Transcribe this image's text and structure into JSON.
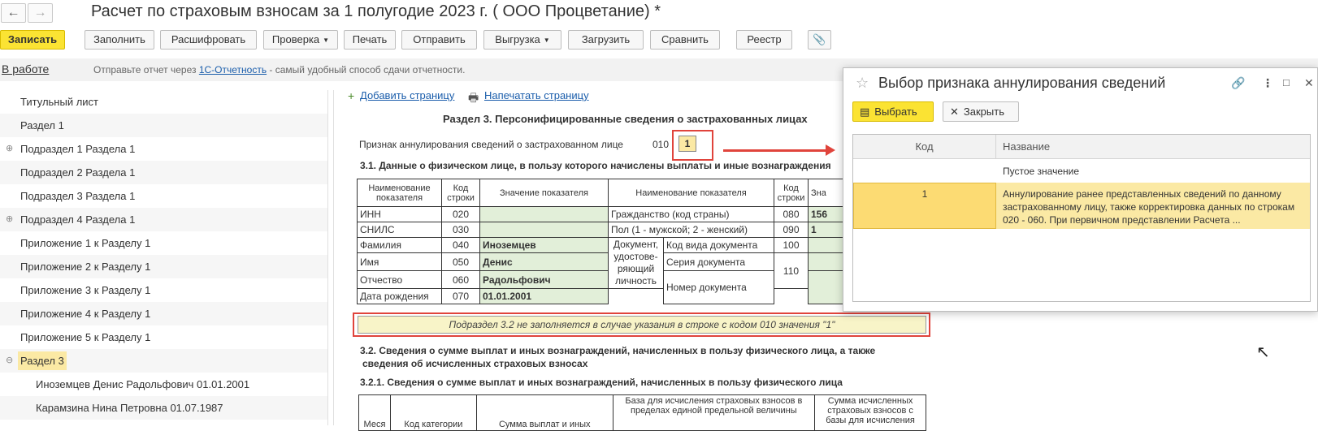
{
  "window": {
    "title": "Расчет по страховым взносам за 1 полугодие 2023 г. ( ООО Процветание) *",
    "back_icon": "arrow-left-icon",
    "forward_icon": "arrow-right-icon"
  },
  "toolbar": {
    "save": "Записать",
    "fill": "Заполнить",
    "decode": "Расшифровать",
    "check": "Проверка",
    "print": "Печать",
    "send": "Отправить",
    "export": "Выгрузка",
    "load": "Загрузить",
    "compare": "Сравнить",
    "registry": "Реестр",
    "attach_icon": "paperclip-icon"
  },
  "infobar": {
    "status": "В работе",
    "text_before": "Отправьте отчет через ",
    "link": "1С-Отчетность",
    "text_after": " - самый удобный способ сдачи отчетности."
  },
  "sidebar": {
    "items": [
      {
        "label": "Титульный лист"
      },
      {
        "label": "Раздел 1"
      },
      {
        "label": "Подраздел 1 Раздела 1",
        "expand": "⊕"
      },
      {
        "label": "Подраздел 2 Раздела 1"
      },
      {
        "label": "Подраздел 3 Раздела 1"
      },
      {
        "label": "Подраздел 4 Раздела 1",
        "expand": "⊕"
      },
      {
        "label": "Приложение 1 к Разделу 1"
      },
      {
        "label": "Приложение 2 к Разделу 1"
      },
      {
        "label": "Приложение 3 к Разделу 1"
      },
      {
        "label": "Приложение 4 к Разделу 1"
      },
      {
        "label": "Приложение 5 к Разделу 1"
      },
      {
        "label": "Раздел 3",
        "expand": "⊖"
      },
      {
        "label": "Иноземцев Денис Радольфович 01.01.2001"
      },
      {
        "label": "Карамзина Нина Петровна 01.07.1987"
      }
    ]
  },
  "report": {
    "add_page": "Добавить страницу",
    "print_page": "Напечатать страницу",
    "section_title": "Раздел 3. Персонифицированные сведения о застрахованных лицах",
    "annul_label": "Признак аннулирования сведений о застрахованном лице",
    "annul_code": "010",
    "annul_value": "1",
    "sub31": "3.1. Данные о физическом лице, в пользу которого начислены выплаты и иные вознаграждения",
    "table": {
      "h_name": "Наименование показателя",
      "h_code": "Код строки",
      "h_value": "Значение показателя",
      "h_name2": "Наименование показателя",
      "h_code2": "Код строки",
      "h_value2": "Зна",
      "rows": [
        {
          "name": "ИНН",
          "code": "020",
          "value": "",
          "name2": "Гражданство (код страны)",
          "code2": "080",
          "value2": "156"
        },
        {
          "name": "СНИЛС",
          "code": "030",
          "value": "",
          "name2": "Пол (1 - мужской; 2 - женский)",
          "code2": "090",
          "value2": "1"
        },
        {
          "name": "Фамилия",
          "code": "040",
          "value": "Иноземцев",
          "name2": "Код вида документа",
          "code2": "100",
          "value2": ""
        },
        {
          "name": "Имя",
          "code": "050",
          "value": "Денис",
          "name2": "Серия документа",
          "code2": "110",
          "value2": ""
        },
        {
          "name": "Отчество",
          "code": "060",
          "value": "Радольфович",
          "name2": "Номер документа",
          "code2": "",
          "value2": ""
        },
        {
          "name": "Дата рождения",
          "code": "070",
          "value": "01.01.2001"
        }
      ],
      "doc_group": "Документ, удостове-ряющий личность"
    },
    "notice": "Подраздел 3.2 не заполняется в случае указания в строке с кодом 010 значения \"1\"",
    "sub32": "3.2. Сведения о сумме выплат и иных вознаграждений, начисленных в пользу физического лица, а также",
    "sub32b": "сведения об исчисленных страховых взносах",
    "sub321": "3.2.1. Сведения о сумме выплат и иных вознаграждений, начисленных в пользу физического лица",
    "t2": {
      "col1": "Меся",
      "col2": "Код категории",
      "col3": "Сумма выплат и иных",
      "col4": "База для исчисления страховых взносов в пределах единой предельной величины",
      "col5": "Сумма исчисленных страховых взносов с базы для исчисления"
    }
  },
  "dialog": {
    "title": "Выбор признака аннулирования сведений",
    "select": "Выбрать",
    "close": "Закрыть",
    "col_code": "Код",
    "col_name": "Название",
    "rows": [
      {
        "code": "",
        "name": "Пустое значение"
      },
      {
        "code": "1",
        "name": "Аннулирование ранее представленных сведений по данному застрахованному лицу, также корректировка данных по строкам 020 - 060. При первичном представлении Расчета ..."
      }
    ]
  },
  "colors": {
    "primary_button": "#fbe333",
    "selection": "#fbe9a4",
    "highlight_red": "#e0443c",
    "link": "#1a5dab",
    "filled_cell": "#e2efd9"
  }
}
